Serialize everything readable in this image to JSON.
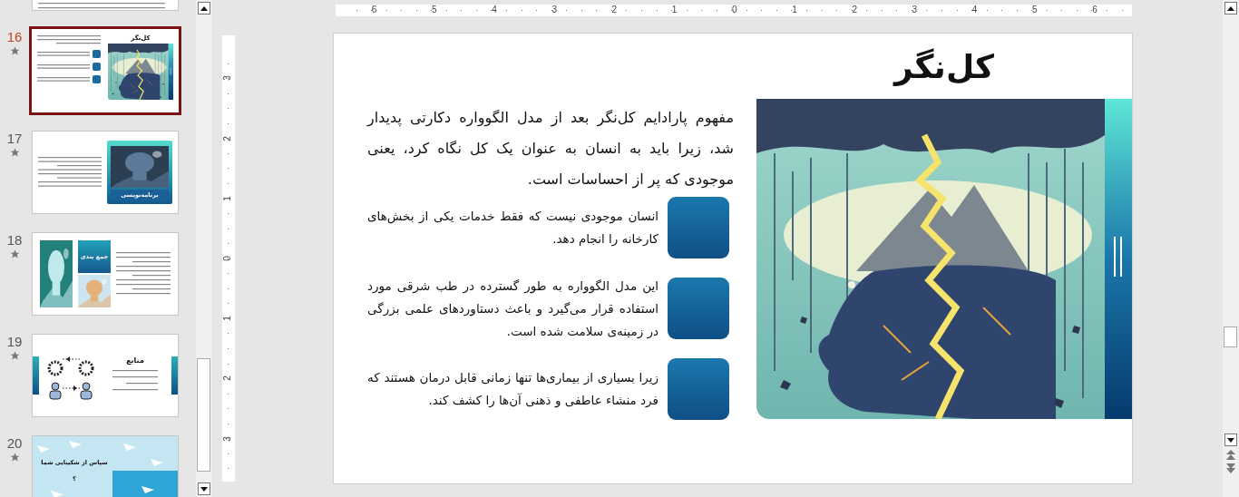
{
  "thumbnails": [
    {
      "kind": "partial",
      "selected": false
    },
    {
      "kind": "image-right",
      "number": "16",
      "selected": true,
      "title": "کل‌نگر"
    },
    {
      "kind": "image-card",
      "number": "17",
      "selected": false,
      "title": "برنامه‌نویسی"
    },
    {
      "kind": "summary",
      "number": "18",
      "selected": false,
      "title": "جمع بندی"
    },
    {
      "kind": "sources",
      "number": "19",
      "selected": false,
      "title": "منابع"
    },
    {
      "kind": "thanks",
      "number": "20",
      "selected": false,
      "title": "سپاس از شکیبایی شما",
      "subtitle": "؟"
    }
  ],
  "ruler": {
    "horizontal": [
      "6",
      "5",
      "4",
      "3",
      "2",
      "1",
      "0",
      "1",
      "2",
      "3",
      "4",
      "5",
      "6"
    ],
    "vertical": [
      "3",
      "2",
      "1",
      "0",
      "1",
      "2",
      "3"
    ]
  },
  "slide": {
    "title": "کل‌نگر",
    "intro": "مفهوم پارادایم کل‌نگر بعد از مدل الگوواره دکارتی پدیدار شد، زیرا باید به انسان به عنوان یک کل نگاه کرد، یعنی موجودی که پر از احساسات است.",
    "points": [
      "انسان موجودی نیست که فقط خدمات یکی از بخش‌های کارخانه را انجام دهد.",
      "این مدل الگوواره به طور گسترده در طب شرقی مورد استفاده قرار می‌گیرد و باعث دستاوردهای علمی بزرگی در زمینه‌ی سلامت شده است.",
      "زیرا بسیاری از بیماری‌ها تنها زمانی قابل درمان هستند که فرد منشاء عاطفی و ذهنی آن‌ها را کشف کند."
    ]
  }
}
